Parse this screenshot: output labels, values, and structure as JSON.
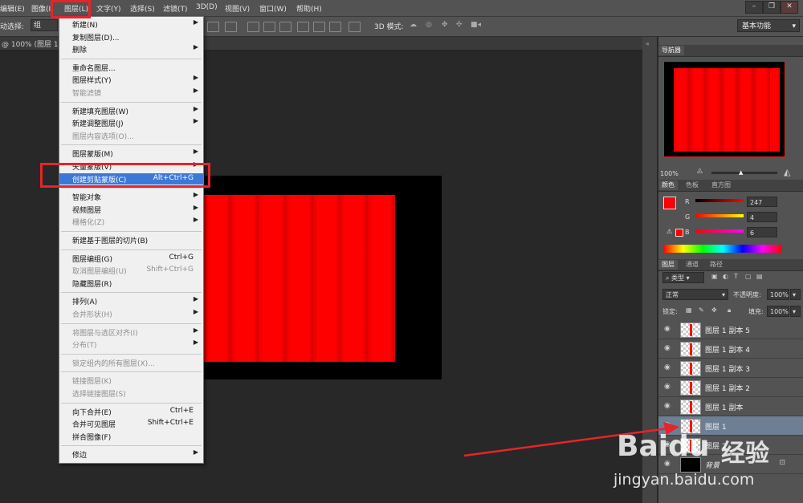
{
  "menubar": {
    "items": [
      "编辑(E)",
      "图像(I)",
      "图层(L)",
      "文字(Y)",
      "选择(S)",
      "滤镜(T)",
      "3D(D)",
      "视图(V)",
      "窗口(W)",
      "帮助(H)"
    ]
  },
  "window_controls": [
    "–",
    "❐",
    "✕"
  ],
  "options_bar": {
    "auto_select_label": "动选择:",
    "auto_select_value": "组",
    "mode_3d_label": "3D 模式:",
    "workspace": "基本功能"
  },
  "document_tab": "@ 100% (图层 1, R",
  "layer_menu": [
    {
      "label": "新建(N)",
      "submenu": true
    },
    {
      "label": "复制图层(D)..."
    },
    {
      "label": "删除",
      "submenu": true
    },
    {
      "sep": true
    },
    {
      "label": "重命名图层..."
    },
    {
      "label": "图层样式(Y)",
      "submenu": true
    },
    {
      "label": "智能滤镜",
      "disabled": true,
      "submenu": true
    },
    {
      "sep": true
    },
    {
      "label": "新建填充图层(W)",
      "submenu": true
    },
    {
      "label": "新建调整图层(J)",
      "submenu": true
    },
    {
      "label": "图层内容选项(O)...",
      "disabled": true
    },
    {
      "sep": true
    },
    {
      "label": "图层蒙版(M)",
      "submenu": true
    },
    {
      "label": "矢量蒙版(V)",
      "submenu": true
    },
    {
      "label": "创建剪贴蒙版(C)",
      "shortcut": "Alt+Ctrl+G",
      "highlighted": true
    },
    {
      "sep": true
    },
    {
      "label": "智能对象",
      "submenu": true
    },
    {
      "label": "视频图层",
      "submenu": true
    },
    {
      "label": "栅格化(Z)",
      "disabled": true,
      "submenu": true
    },
    {
      "sep": true
    },
    {
      "label": "新建基于图层的切片(B)"
    },
    {
      "sep": true
    },
    {
      "label": "图层编组(G)",
      "shortcut": "Ctrl+G"
    },
    {
      "label": "取消图层编组(U)",
      "shortcut": "Shift+Ctrl+G",
      "disabled": true
    },
    {
      "label": "隐藏图层(R)"
    },
    {
      "sep": true
    },
    {
      "label": "排列(A)",
      "submenu": true
    },
    {
      "label": "合并形状(H)",
      "disabled": true,
      "submenu": true
    },
    {
      "sep": true
    },
    {
      "label": "将图层与选区对齐(I)",
      "disabled": true,
      "submenu": true
    },
    {
      "label": "分布(T)",
      "disabled": true,
      "submenu": true
    },
    {
      "sep": true
    },
    {
      "label": "锁定组内的所有图层(X)...",
      "disabled": true
    },
    {
      "sep": true
    },
    {
      "label": "链接图层(K)",
      "disabled": true
    },
    {
      "label": "选择链接图层(S)",
      "disabled": true
    },
    {
      "sep": true
    },
    {
      "label": "向下合并(E)",
      "shortcut": "Ctrl+E"
    },
    {
      "label": "合并可见图层",
      "shortcut": "Shift+Ctrl+E"
    },
    {
      "label": "拼合图像(F)"
    },
    {
      "sep": true
    },
    {
      "label": "修边",
      "submenu": true
    }
  ],
  "navigator": {
    "tab": "导航器",
    "zoom": "100%"
  },
  "color_panel": {
    "tabs": [
      "颜色",
      "色板",
      "直方图"
    ],
    "r_label": "R",
    "g_label": "G",
    "b_label": "B",
    "r": "247",
    "g": "4",
    "b": "6",
    "foreground": "#f70406"
  },
  "layers_panel": {
    "tabs": [
      "图层",
      "通道",
      "路径"
    ],
    "filter_kind": "类型",
    "blend_mode": "正常",
    "opacity_label": "不透明度:",
    "opacity": "100%",
    "lock_label": "锁定:",
    "fill_label": "填充:",
    "fill": "100%",
    "layers": [
      {
        "name": "图层 1 副本 5"
      },
      {
        "name": "图层 1 副本 4"
      },
      {
        "name": "图层 1 副本 3"
      },
      {
        "name": "图层 1 副本 2"
      },
      {
        "name": "图层 1 副本"
      },
      {
        "name": "图层 1",
        "selected": true
      },
      {
        "name": "图层 2"
      },
      {
        "name": "背景",
        "locked": true
      }
    ]
  },
  "watermark": {
    "brand": "Baidu",
    "brand_cn": "经验",
    "url": "jingyan.baidu.com"
  }
}
